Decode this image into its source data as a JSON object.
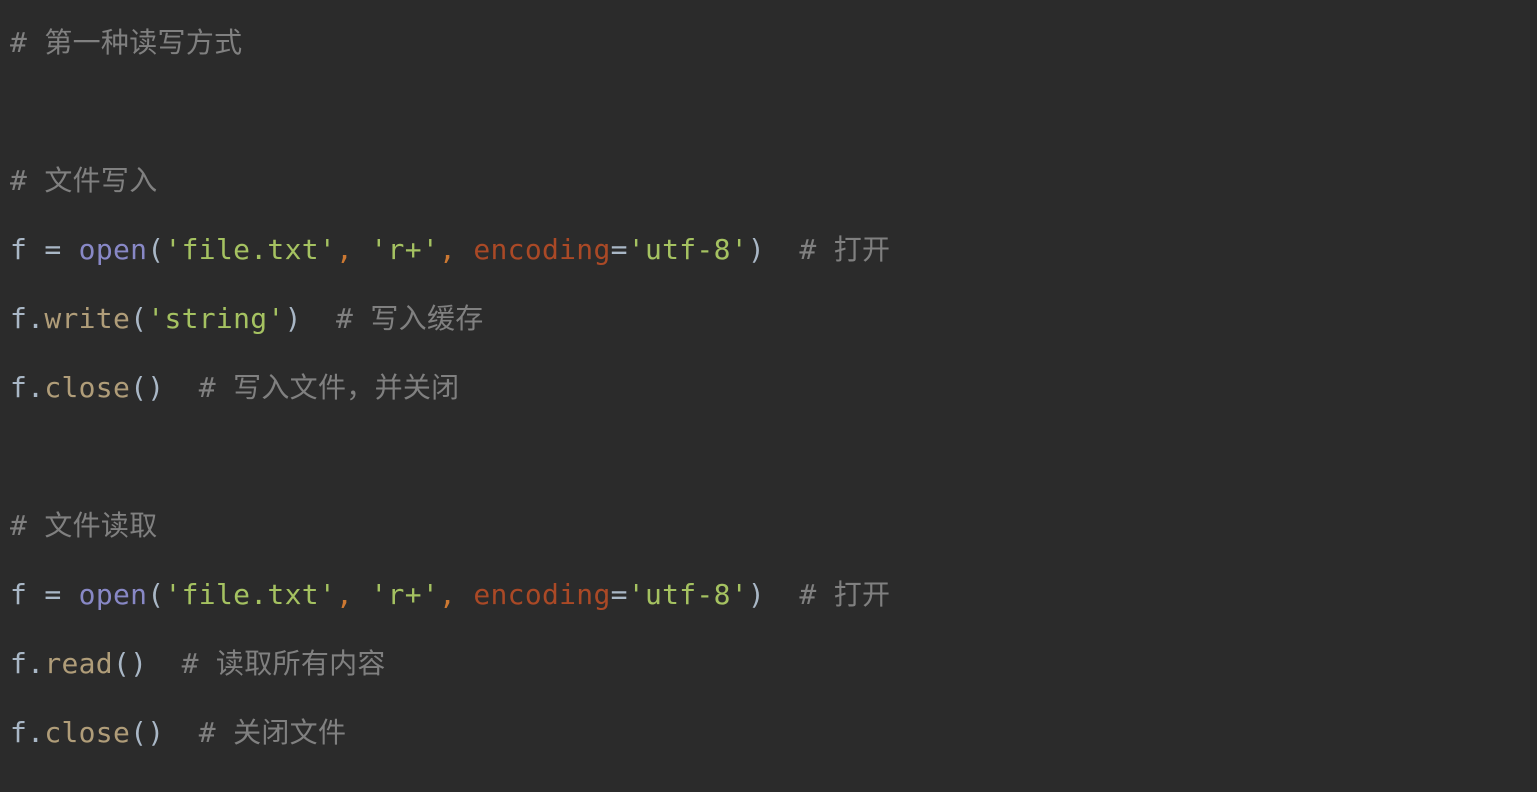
{
  "lines": [
    [
      {
        "cls": "tok-comment",
        "bind": "code.l1.comment"
      }
    ],
    [],
    [
      {
        "cls": "tok-comment",
        "bind": "code.l3.comment"
      }
    ],
    [
      {
        "cls": "tok-variable",
        "bind": "code.l4.var"
      },
      {
        "cls": "tok-operator",
        "bind": "code.l4.assign"
      },
      {
        "cls": "tok-builtin",
        "bind": "code.l4.open"
      },
      {
        "cls": "tok-paren",
        "bind": "code.l4.lp"
      },
      {
        "cls": "tok-string",
        "bind": "code.l4.filearg"
      },
      {
        "cls": "tok-punct",
        "bind": "code.l4.comma1"
      },
      {
        "cls": "tok-string",
        "bind": "code.l4.modearg"
      },
      {
        "cls": "tok-punct",
        "bind": "code.l4.comma2"
      },
      {
        "cls": "tok-kwarg",
        "bind": "code.l4.enckw"
      },
      {
        "cls": "tok-operator",
        "bind": "code.l4.eq"
      },
      {
        "cls": "tok-string",
        "bind": "code.l4.encval"
      },
      {
        "cls": "tok-paren",
        "bind": "code.l4.rp"
      },
      {
        "cls": "tok-comment",
        "bind": "code.l4.trail"
      }
    ],
    [
      {
        "cls": "tok-variable",
        "bind": "code.l5.obj"
      },
      {
        "cls": "tok-member",
        "bind": "code.l5.method"
      },
      {
        "cls": "tok-paren",
        "bind": "code.l5.lp"
      },
      {
        "cls": "tok-string",
        "bind": "code.l5.arg"
      },
      {
        "cls": "tok-paren",
        "bind": "code.l5.rp"
      },
      {
        "cls": "tok-comment",
        "bind": "code.l5.trail"
      }
    ],
    [
      {
        "cls": "tok-variable",
        "bind": "code.l6.obj"
      },
      {
        "cls": "tok-member",
        "bind": "code.l6.method"
      },
      {
        "cls": "tok-paren",
        "bind": "code.l6.parens"
      },
      {
        "cls": "tok-comment",
        "bind": "code.l6.trail"
      }
    ],
    [],
    [
      {
        "cls": "tok-comment",
        "bind": "code.l8.comment"
      }
    ],
    [
      {
        "cls": "tok-variable",
        "bind": "code.l9.var"
      },
      {
        "cls": "tok-operator",
        "bind": "code.l9.assign"
      },
      {
        "cls": "tok-builtin",
        "bind": "code.l9.open"
      },
      {
        "cls": "tok-paren",
        "bind": "code.l9.lp"
      },
      {
        "cls": "tok-string",
        "bind": "code.l9.filearg"
      },
      {
        "cls": "tok-punct",
        "bind": "code.l9.comma1"
      },
      {
        "cls": "tok-string",
        "bind": "code.l9.modearg"
      },
      {
        "cls": "tok-punct",
        "bind": "code.l9.comma2"
      },
      {
        "cls": "tok-kwarg",
        "bind": "code.l9.enckw"
      },
      {
        "cls": "tok-operator",
        "bind": "code.l9.eq"
      },
      {
        "cls": "tok-string",
        "bind": "code.l9.encval"
      },
      {
        "cls": "tok-paren",
        "bind": "code.l9.rp"
      },
      {
        "cls": "tok-comment",
        "bind": "code.l9.trail"
      }
    ],
    [
      {
        "cls": "tok-variable",
        "bind": "code.l10.obj"
      },
      {
        "cls": "tok-member",
        "bind": "code.l10.method"
      },
      {
        "cls": "tok-paren",
        "bind": "code.l10.parens"
      },
      {
        "cls": "tok-comment",
        "bind": "code.l10.trail"
      }
    ],
    [
      {
        "cls": "tok-variable",
        "bind": "code.l11.obj"
      },
      {
        "cls": "tok-member",
        "bind": "code.l11.method"
      },
      {
        "cls": "tok-paren",
        "bind": "code.l11.parens"
      },
      {
        "cls": "tok-comment",
        "bind": "code.l11.trail"
      }
    ]
  ],
  "code": {
    "l1": {
      "comment": "# 第一种读写方式"
    },
    "l3": {
      "comment": "# 文件写入"
    },
    "l4": {
      "var": "f",
      "assign": " = ",
      "open": "open",
      "lp": "(",
      "filearg": "'file.txt'",
      "comma1": ", ",
      "modearg": "'r+'",
      "comma2": ", ",
      "enckw": "encoding",
      "eq": "=",
      "encval": "'utf-8'",
      "rp": ")",
      "trail": "  # 打开"
    },
    "l5": {
      "obj": "f.",
      "method": "write",
      "lp": "(",
      "arg": "'string'",
      "rp": ")",
      "trail": "  # 写入缓存"
    },
    "l6": {
      "obj": "f.",
      "method": "close",
      "parens": "()",
      "trail": "  # 写入文件，并关闭"
    },
    "l8": {
      "comment": "# 文件读取"
    },
    "l9": {
      "var": "f",
      "assign": " = ",
      "open": "open",
      "lp": "(",
      "filearg": "'file.txt'",
      "comma1": ", ",
      "modearg": "'r+'",
      "comma2": ", ",
      "enckw": "encoding",
      "eq": "=",
      "encval": "'utf-8'",
      "rp": ")",
      "trail": "  # 打开"
    },
    "l10": {
      "obj": "f.",
      "method": "read",
      "parens": "()",
      "trail": "  # 读取所有内容"
    },
    "l11": {
      "obj": "f.",
      "method": "close",
      "parens": "()",
      "trail": "  # 关闭文件"
    }
  }
}
